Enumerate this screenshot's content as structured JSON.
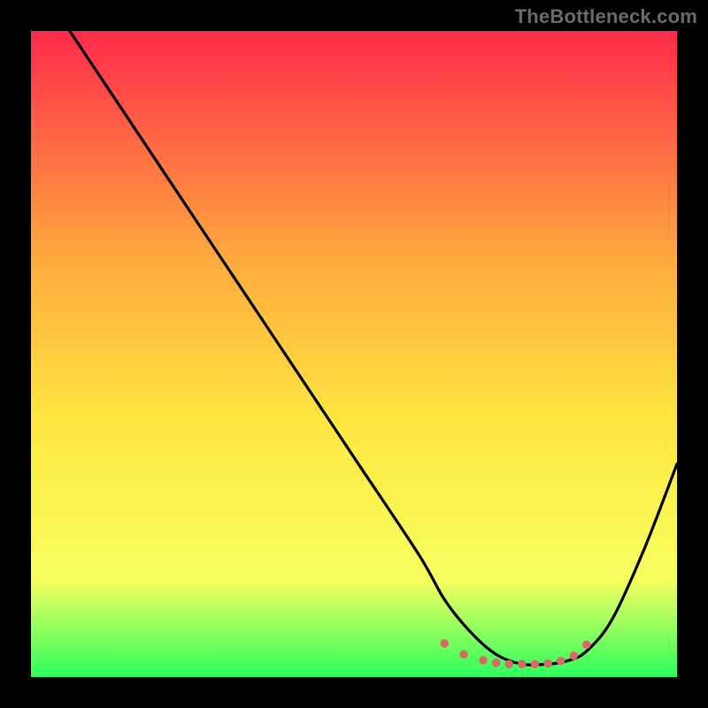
{
  "watermark": "TheBottleneck.com",
  "chart_data": {
    "type": "line",
    "title": "",
    "xlabel": "",
    "ylabel": "",
    "xlim": [
      0,
      100
    ],
    "ylim": [
      0,
      100
    ],
    "grid": false,
    "legend": false,
    "background_gradient": {
      "top": "#ff2a4b",
      "upper_mid": "#ffa93e",
      "mid": "#ffe640",
      "lower_mid": "#f7ff60",
      "bottom": "#2bff5e"
    },
    "series": [
      {
        "name": "bottleneck-curve",
        "color": "#000000",
        "x": [
          6,
          12,
          20,
          30,
          40,
          50,
          60,
          64,
          68,
          72,
          76,
          80,
          83,
          86,
          90,
          95,
          100
        ],
        "y": [
          100,
          91,
          79,
          64,
          49,
          34,
          19,
          12,
          7,
          3.5,
          2,
          2,
          2.5,
          4,
          9,
          20,
          33
        ]
      }
    ],
    "markers": {
      "name": "bottom-points",
      "color": "#d86a66",
      "radius": 4.8,
      "x": [
        64,
        67,
        70,
        72,
        74,
        76,
        78,
        80,
        82,
        84,
        86
      ],
      "y": [
        5.2,
        3.5,
        2.6,
        2.2,
        2.0,
        2.0,
        2.0,
        2.1,
        2.5,
        3.3,
        5.0
      ]
    }
  }
}
